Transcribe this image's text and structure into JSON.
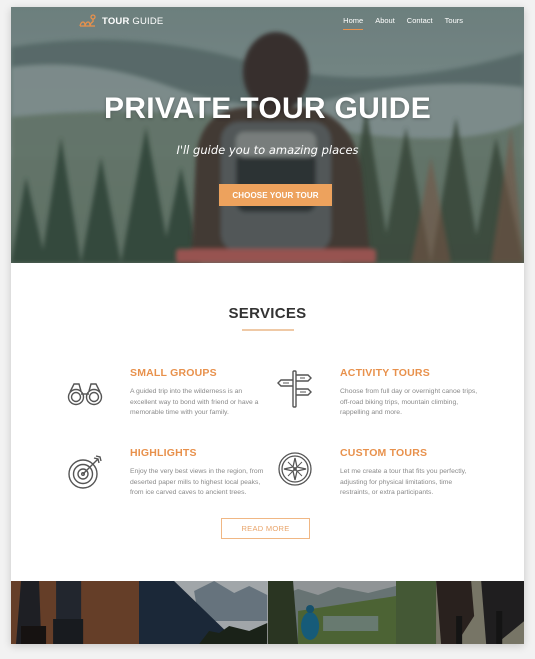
{
  "nav": {
    "logo_bold": "TOUR",
    "logo_light": " GUIDE",
    "logo_icon": "map-route-icon",
    "items": [
      {
        "label": "Home",
        "active": true
      },
      {
        "label": "About",
        "active": false
      },
      {
        "label": "Contact",
        "active": false
      },
      {
        "label": "Tours",
        "active": false
      }
    ]
  },
  "hero": {
    "title": "PRIVATE TOUR GUIDE",
    "subtitle": "I'll guide you to amazing places",
    "cta_label": "CHOOSE YOUR TOUR"
  },
  "services": {
    "title": "SERVICES",
    "items": [
      {
        "icon": "binoculars-icon",
        "title": "SMALL GROUPS",
        "text": "A guided trip into the wilderness is an excellent way to bond with friend or have a memorable time with your family."
      },
      {
        "icon": "signpost-icon",
        "title": "ACTIVITY TOURS",
        "text": "Choose from full day or overnight canoe trips, off-road biking trips, mountain climbing, rappelling and more."
      },
      {
        "icon": "target-icon",
        "title": "HIGHLIGHTS",
        "text": "Enjoy the very best views in the region, from deserted paper mills to highest local peaks, from ice carved caves to ancient trees."
      },
      {
        "icon": "compass-icon",
        "title": "CUSTOM TOURS",
        "text": "Let me create a tour that fits you perfectly, adjusting for physical limitations, time restraints, or extra participants."
      }
    ],
    "read_more_label": "READ MORE"
  },
  "gallery": {
    "tiles": [
      "hiking-boots-photo",
      "mountain-range-photo",
      "hiker-lake-photo",
      "mountain-bikers-photo"
    ]
  },
  "colors": {
    "accent": "#eda25d",
    "accent_text": "#e8914c",
    "heading": "#333333",
    "body_text": "#8a8a8a"
  }
}
